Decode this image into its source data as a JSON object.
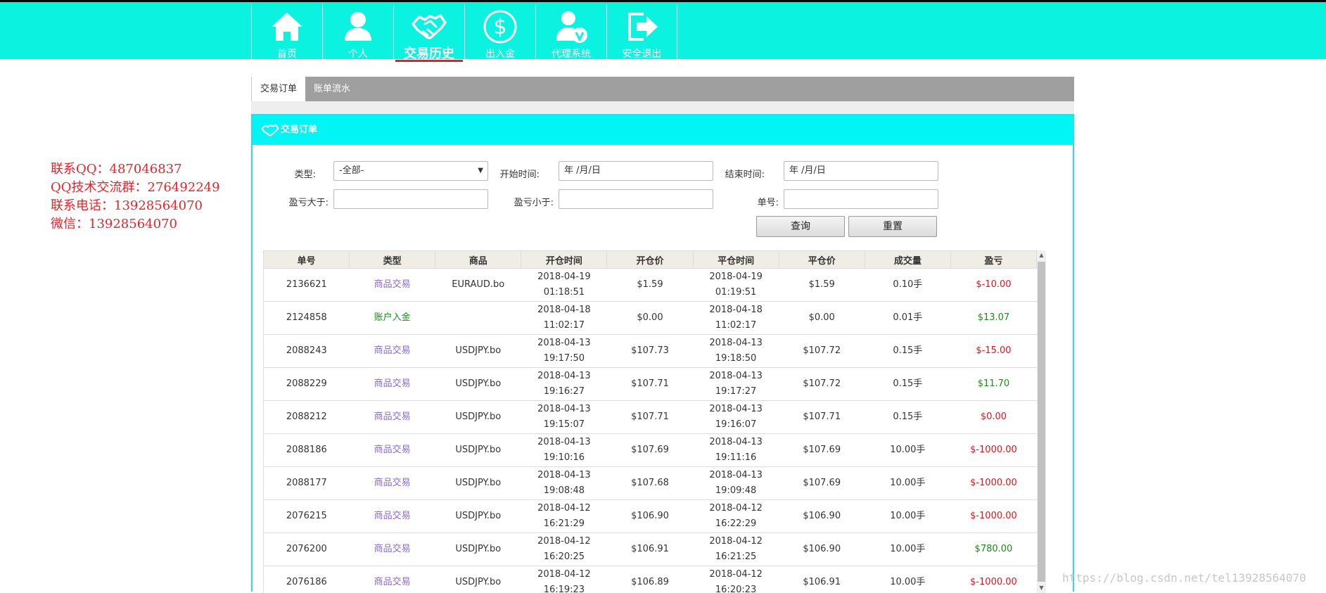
{
  "nav": [
    {
      "label": "首页",
      "icon": "home-icon"
    },
    {
      "label": "个人",
      "icon": "user-icon"
    },
    {
      "label": "交易历史",
      "icon": "handshake-icon",
      "active": true
    },
    {
      "label": "出入金",
      "icon": "dollar-icon"
    },
    {
      "label": "代理系统",
      "icon": "agent-icon"
    },
    {
      "label": "安全退出",
      "icon": "logout-icon"
    }
  ],
  "contact": [
    "联系QQ：487046837",
    "QQ技术交流群：276492249",
    "联系电话：13928564070",
    "微信：13928564070"
  ],
  "tabs": [
    "交易订单",
    "账单流水"
  ],
  "panel_title": "交易订单",
  "filters": {
    "type_label": "类型:",
    "type_value": "-全部-",
    "start_label": "开始时间:",
    "start_placeholder": "年 /月/日",
    "end_label": "结束时间:",
    "end_placeholder": "年 /月/日",
    "pl_gt_label": "盈亏大于:",
    "pl_lt_label": "盈亏小于:",
    "order_label": "单号:",
    "query_button": "查询",
    "reset_button": "重置"
  },
  "table": {
    "headers": [
      "单号",
      "类型",
      "商品",
      "开仓时间",
      "开仓价",
      "平仓时间",
      "平仓价",
      "成交量",
      "盈亏"
    ],
    "rows": [
      {
        "id": "2136621",
        "type": "商品交易",
        "type_kind": "goods",
        "goods": "EURAUD.bo",
        "open_date": "2018-04-19",
        "open_time": "01:18:51",
        "open_price": "$1.59",
        "close_date": "2018-04-19",
        "close_time": "01:19:51",
        "close_price": "$1.59",
        "volume": "0.10手",
        "pl": "$-10.00",
        "pl_kind": "neg"
      },
      {
        "id": "2124858",
        "type": "账户入金",
        "type_kind": "deposit",
        "goods": "",
        "open_date": "2018-04-18",
        "open_time": "11:02:17",
        "open_price": "$0.00",
        "close_date": "2018-04-18",
        "close_time": "11:02:17",
        "close_price": "$0.00",
        "volume": "0.01手",
        "pl": "$13.07",
        "pl_kind": "pos"
      },
      {
        "id": "2088243",
        "type": "商品交易",
        "type_kind": "goods",
        "goods": "USDJPY.bo",
        "open_date": "2018-04-13",
        "open_time": "19:17:50",
        "open_price": "$107.73",
        "close_date": "2018-04-13",
        "close_time": "19:18:50",
        "close_price": "$107.72",
        "volume": "0.15手",
        "pl": "$-15.00",
        "pl_kind": "neg"
      },
      {
        "id": "2088229",
        "type": "商品交易",
        "type_kind": "goods",
        "goods": "USDJPY.bo",
        "open_date": "2018-04-13",
        "open_time": "19:16:27",
        "open_price": "$107.71",
        "close_date": "2018-04-13",
        "close_time": "19:17:27",
        "close_price": "$107.72",
        "volume": "0.15手",
        "pl": "$11.70",
        "pl_kind": "pos"
      },
      {
        "id": "2088212",
        "type": "商品交易",
        "type_kind": "goods",
        "goods": "USDJPY.bo",
        "open_date": "2018-04-13",
        "open_time": "19:15:07",
        "open_price": "$107.71",
        "close_date": "2018-04-13",
        "close_time": "19:16:07",
        "close_price": "$107.71",
        "volume": "0.15手",
        "pl": "$0.00",
        "pl_kind": "neg"
      },
      {
        "id": "2088186",
        "type": "商品交易",
        "type_kind": "goods",
        "goods": "USDJPY.bo",
        "open_date": "2018-04-13",
        "open_time": "19:10:16",
        "open_price": "$107.69",
        "close_date": "2018-04-13",
        "close_time": "19:11:16",
        "close_price": "$107.69",
        "volume": "10.00手",
        "pl": "$-1000.00",
        "pl_kind": "neg"
      },
      {
        "id": "2088177",
        "type": "商品交易",
        "type_kind": "goods",
        "goods": "USDJPY.bo",
        "open_date": "2018-04-13",
        "open_time": "19:08:48",
        "open_price": "$107.68",
        "close_date": "2018-04-13",
        "close_time": "19:09:48",
        "close_price": "$107.69",
        "volume": "10.00手",
        "pl": "$-1000.00",
        "pl_kind": "neg"
      },
      {
        "id": "2076215",
        "type": "商品交易",
        "type_kind": "goods",
        "goods": "USDJPY.bo",
        "open_date": "2018-04-12",
        "open_time": "16:21:29",
        "open_price": "$106.90",
        "close_date": "2018-04-12",
        "close_time": "16:22:29",
        "close_price": "$106.90",
        "volume": "10.00手",
        "pl": "$-1000.00",
        "pl_kind": "neg"
      },
      {
        "id": "2076200",
        "type": "商品交易",
        "type_kind": "goods",
        "goods": "USDJPY.bo",
        "open_date": "2018-04-12",
        "open_time": "16:20:25",
        "open_price": "$106.91",
        "close_date": "2018-04-12",
        "close_time": "16:21:25",
        "close_price": "$106.90",
        "volume": "10.00手",
        "pl": "$780.00",
        "pl_kind": "pos"
      },
      {
        "id": "2076186",
        "type": "商品交易",
        "type_kind": "goods",
        "goods": "USDJPY.bo",
        "open_date": "2018-04-12",
        "open_time": "16:19:23",
        "open_price": "$106.89",
        "close_date": "2018-04-12",
        "close_time": "16:20:23",
        "close_price": "$106.91",
        "volume": "10.00手",
        "pl": "$-1000.00",
        "pl_kind": "neg"
      }
    ]
  },
  "watermark": "https://blog.csdn.net/tel13928564070",
  "colors": {
    "nav_bg": "#0cf2e0",
    "panel_head": "#00f5f5",
    "negative": "#e0141b",
    "positive": "#1a8a1a",
    "goods_type": "#8a67d6",
    "contact_text": "#e8232b"
  }
}
